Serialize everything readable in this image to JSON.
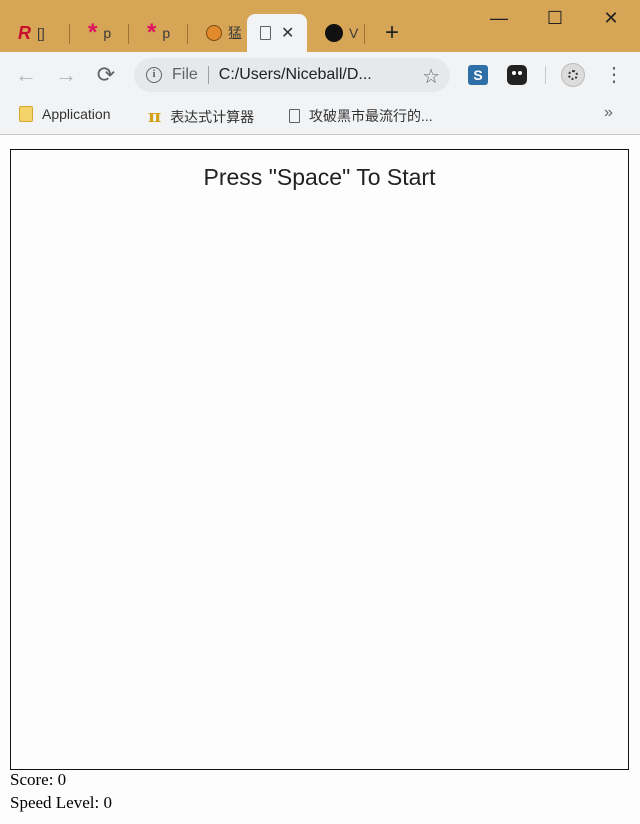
{
  "browser": {
    "tabs": [
      {
        "icon": "r-logo-icon",
        "label": "[]"
      },
      {
        "icon": "asterisk-pink-icon",
        "label": "p"
      },
      {
        "icon": "asterisk-pink-icon",
        "label": "p"
      },
      {
        "icon": "tiger-icon",
        "label": "猛"
      },
      {
        "icon": "page-icon",
        "label": "",
        "active": true
      },
      {
        "icon": "github-icon",
        "label": "V"
      }
    ],
    "new_tab_symbol": "+",
    "window_controls": {
      "minimize": "—",
      "maximize": "☐",
      "close": "✕"
    },
    "nav": {
      "back": "←",
      "forward": "→",
      "reload": "⟳"
    },
    "address": {
      "scheme": "File",
      "url": "C:/Users/Niceball/D..."
    },
    "star_symbol": "☆",
    "extensions": [
      {
        "icon": "s-extension-icon",
        "label": "S"
      },
      {
        "icon": "tampermonkey-icon"
      }
    ],
    "menu_symbol": "⋮",
    "bookmarks": [
      {
        "icon": "folder-icon",
        "label": "Application"
      },
      {
        "icon": "pi-icon",
        "label": "表达式计算器",
        "glyph": "π"
      },
      {
        "icon": "page-icon",
        "label": "攻破黑市最流行的..."
      }
    ],
    "bookmarks_more": "»",
    "colors": {
      "tab_strip": "#d6a556",
      "toolbar": "#f1f3f4"
    }
  },
  "page": {
    "start_message": "Press \"Space\" To Start",
    "score_label": "Score: 0",
    "speed_label": "Speed Level: 0"
  }
}
